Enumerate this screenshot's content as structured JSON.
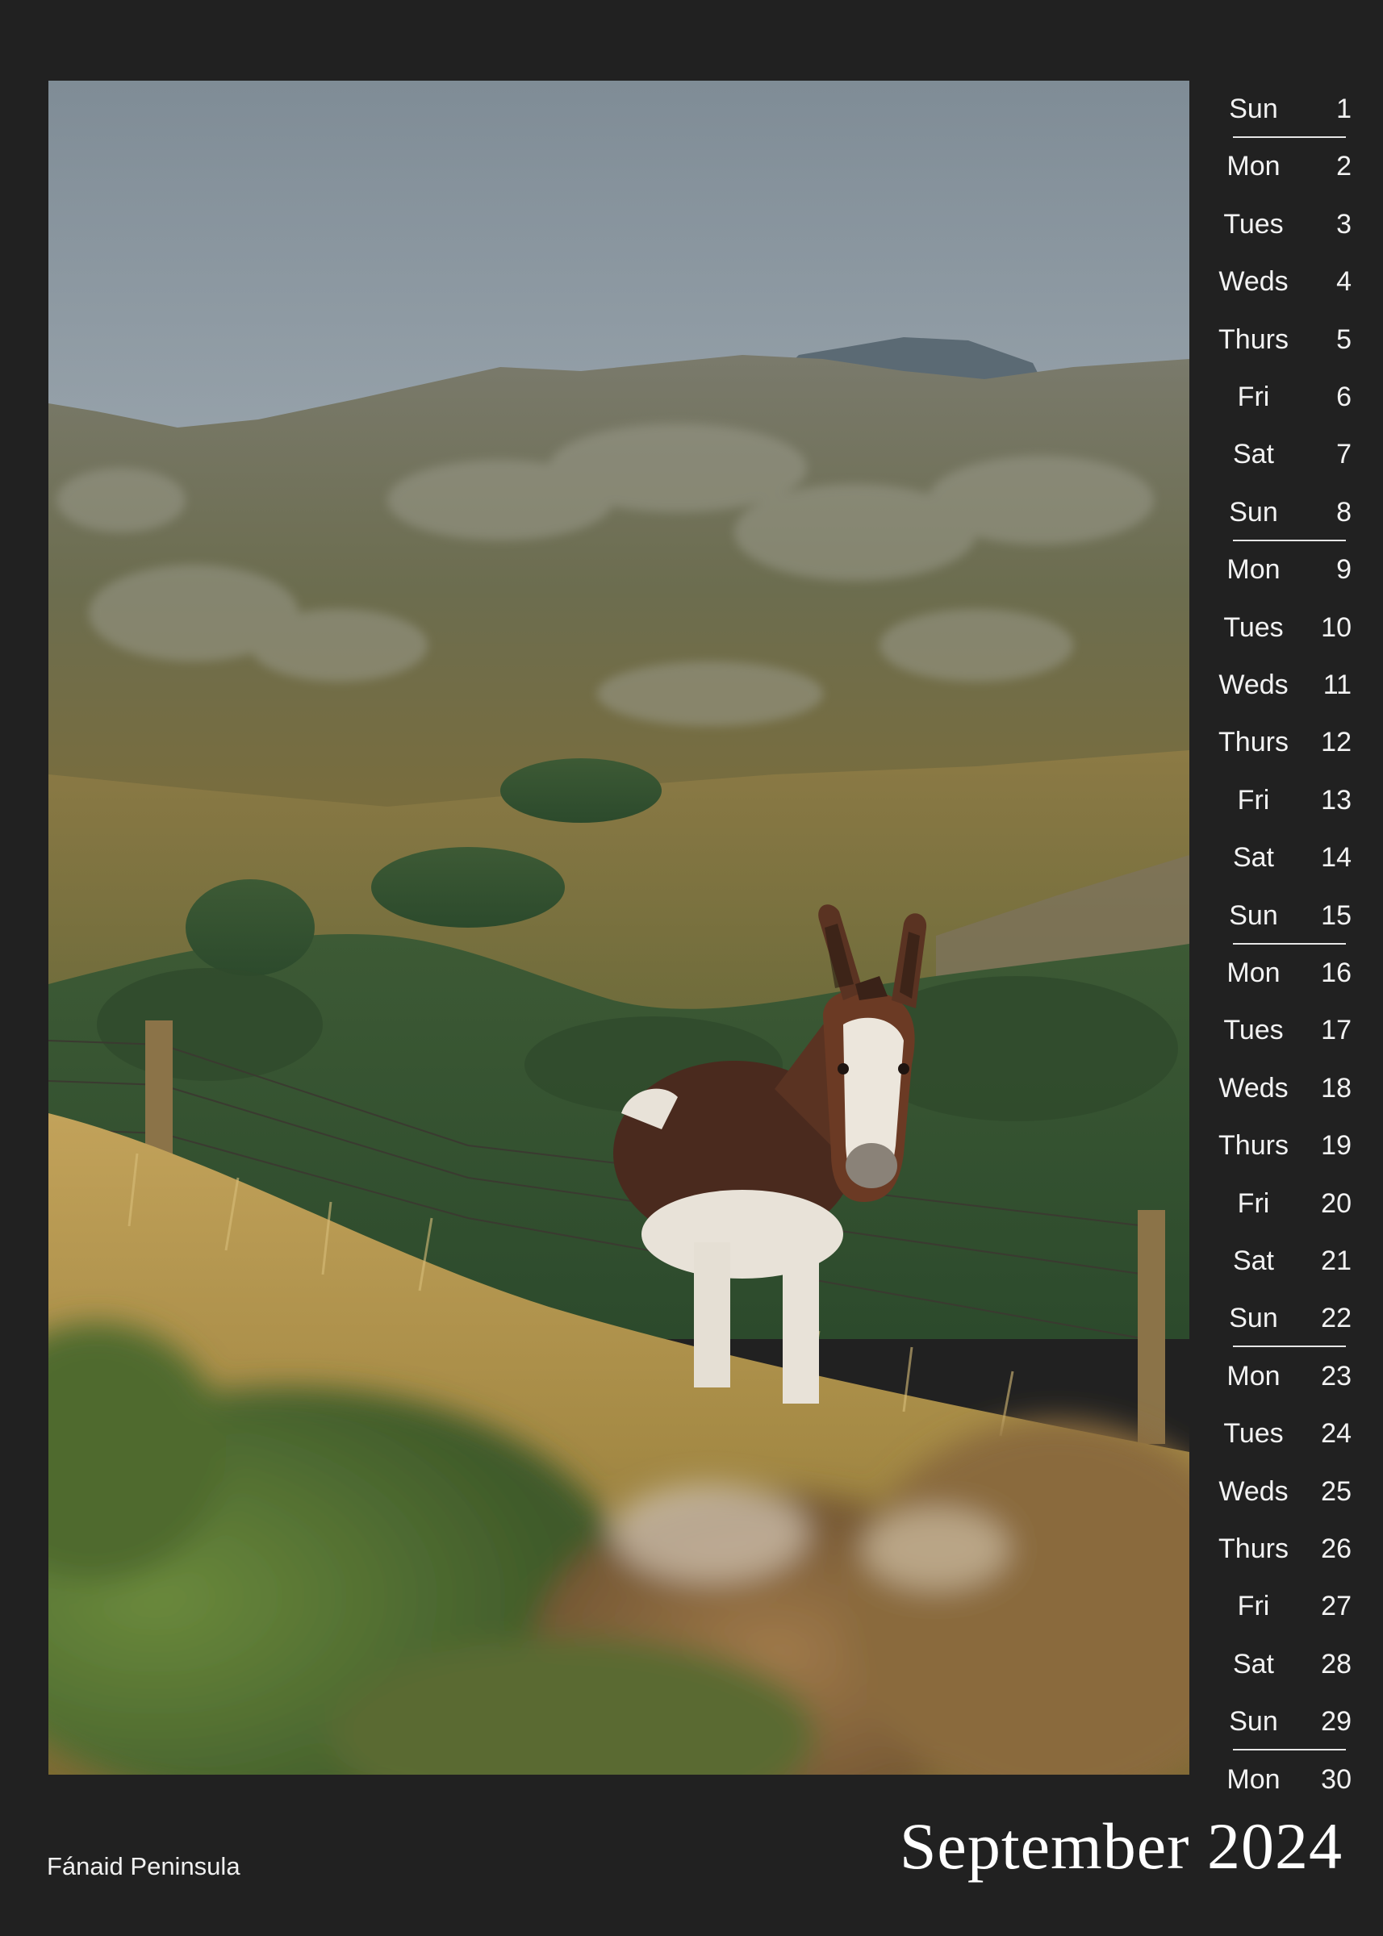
{
  "calendar": {
    "month": "September",
    "year": "2024",
    "title": "September 2024",
    "location": "Fánaid Peninsula",
    "days": [
      {
        "name": "Sun",
        "num": "1"
      },
      {
        "name": "Mon",
        "num": "2"
      },
      {
        "name": "Tues",
        "num": "3"
      },
      {
        "name": "Weds",
        "num": "4"
      },
      {
        "name": "Thurs",
        "num": "5"
      },
      {
        "name": "Fri",
        "num": "6"
      },
      {
        "name": "Sat",
        "num": "7"
      },
      {
        "name": "Sun",
        "num": "8"
      },
      {
        "name": "Mon",
        "num": "9"
      },
      {
        "name": "Tues",
        "num": "10"
      },
      {
        "name": "Weds",
        "num": "11"
      },
      {
        "name": "Thurs",
        "num": "12"
      },
      {
        "name": "Fri",
        "num": "13"
      },
      {
        "name": "Sat",
        "num": "14"
      },
      {
        "name": "Sun",
        "num": "15"
      },
      {
        "name": "Mon",
        "num": "16"
      },
      {
        "name": "Tues",
        "num": "17"
      },
      {
        "name": "Weds",
        "num": "18"
      },
      {
        "name": "Thurs",
        "num": "19"
      },
      {
        "name": "Fri",
        "num": "20"
      },
      {
        "name": "Sat",
        "num": "21"
      },
      {
        "name": "Sun",
        "num": "22"
      },
      {
        "name": "Mon",
        "num": "23"
      },
      {
        "name": "Tues",
        "num": "24"
      },
      {
        "name": "Weds",
        "num": "25"
      },
      {
        "name": "Thurs",
        "num": "26"
      },
      {
        "name": "Fri",
        "num": "27"
      },
      {
        "name": "Sat",
        "num": "28"
      },
      {
        "name": "Sun",
        "num": "29"
      },
      {
        "name": "Mon",
        "num": "30"
      }
    ]
  },
  "colors": {
    "background": "#212121",
    "text": "#ffffff"
  }
}
